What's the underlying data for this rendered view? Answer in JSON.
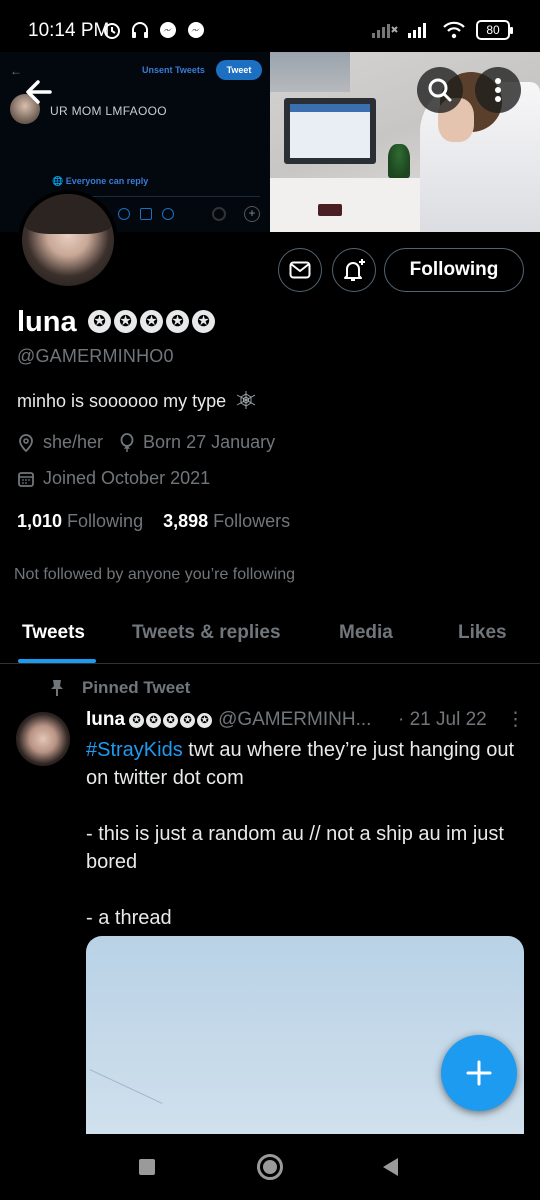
{
  "status_bar": {
    "time": "10:14 PM",
    "battery": "80"
  },
  "banner": {
    "unsent_tweets": "Unsent Tweets",
    "tweet_button": "Tweet",
    "name_caption": "UR MOM LMFAOOO",
    "everyone_can_reply": "Everyone can reply"
  },
  "profile": {
    "display_name": "luna",
    "stars": [
      "✪",
      "✪",
      "✪",
      "✪",
      "✪"
    ],
    "handle": "@GAMERMINHO0",
    "bio": "minho is soooooo my type",
    "pronouns": "she/her",
    "birthday": "Born 27 January",
    "joined": "Joined October 2021",
    "following_count": "1,010",
    "following_label": "Following",
    "followers_count": "3,898",
    "followers_label": "Followers",
    "not_followed": "Not followed by anyone you’re following",
    "follow_button": "Following"
  },
  "tabs": [
    {
      "label": "Tweets",
      "active": true
    },
    {
      "label": "Tweets & replies",
      "active": false
    },
    {
      "label": "Media",
      "active": false
    },
    {
      "label": "Likes",
      "active": false
    }
  ],
  "pinned_tweet": {
    "pinned_label": "Pinned Tweet",
    "name": "luna",
    "handle": "@GAMERMINH...",
    "date": "· 21 Jul 22",
    "hashtag": "#StrayKids",
    "line1_rest": " twt au where they’re just hanging out on twitter dot com",
    "para2": "- this is just a random au // not a ship au im just bored",
    "para3": "- a thread"
  },
  "colors": {
    "accent": "#1d9bf0",
    "background": "#000000",
    "text_secondary": "#71767b"
  },
  "icons": {
    "back": "arrow-left-icon",
    "search": "search-icon",
    "more": "more-vertical-icon",
    "message": "envelope-icon",
    "notify": "bell-plus-icon",
    "location": "location-pin-icon",
    "birthday": "balloon-icon",
    "calendar": "calendar-icon",
    "pin": "pin-icon",
    "compose": "plus-icon"
  }
}
